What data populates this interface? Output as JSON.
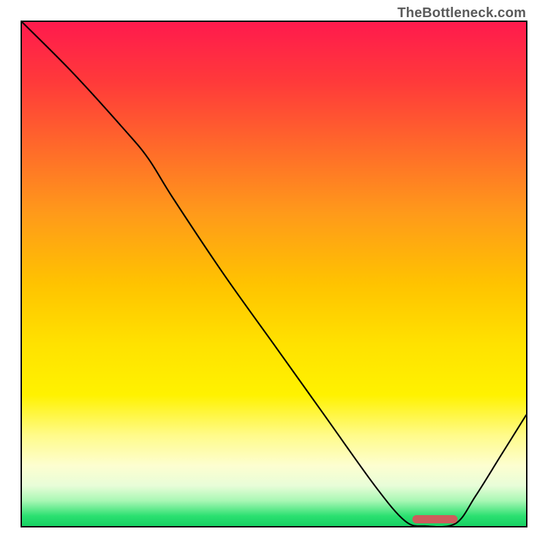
{
  "watermark": "TheBottleneck.com",
  "chart_data": {
    "type": "line",
    "title": "",
    "xlabel": "",
    "ylabel": "",
    "xlim": [
      0,
      100
    ],
    "ylim": [
      0,
      100
    ],
    "grid": false,
    "legend": false,
    "series": [
      {
        "name": "bottleneck-curve",
        "x": [
          0,
          10,
          20,
          25,
          30,
          40,
          50,
          60,
          70,
          76,
          80,
          86,
          90,
          95,
          100
        ],
        "values": [
          100,
          90,
          79,
          73,
          65,
          50,
          36,
          22,
          8,
          1,
          0,
          0.5,
          6,
          14,
          22
        ]
      }
    ],
    "marker": {
      "name": "optimal-range",
      "x_start": 77,
      "x_end": 86,
      "color": "#cd5c5c"
    },
    "gradient_stops": [
      {
        "offset": 0,
        "color": "#ff1a4d"
      },
      {
        "offset": 12,
        "color": "#ff3a3a"
      },
      {
        "offset": 25,
        "color": "#ff6a2a"
      },
      {
        "offset": 38,
        "color": "#ff9a1a"
      },
      {
        "offset": 52,
        "color": "#ffc300"
      },
      {
        "offset": 64,
        "color": "#ffe200"
      },
      {
        "offset": 74,
        "color": "#fff200"
      },
      {
        "offset": 82,
        "color": "#fffb8a"
      },
      {
        "offset": 88,
        "color": "#fdfed0"
      },
      {
        "offset": 92,
        "color": "#e8fdd8"
      },
      {
        "offset": 95,
        "color": "#a8f7b4"
      },
      {
        "offset": 98,
        "color": "#2be070"
      },
      {
        "offset": 100,
        "color": "#15d062"
      }
    ]
  }
}
